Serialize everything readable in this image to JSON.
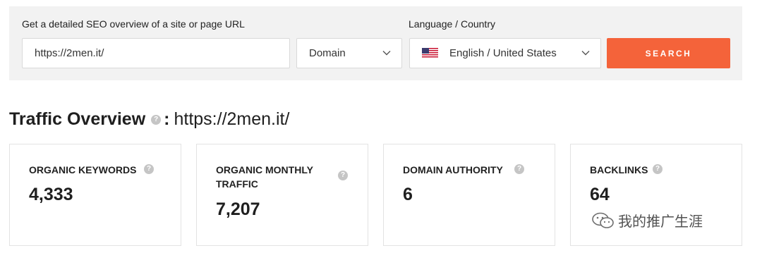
{
  "search": {
    "url_label": "Get a detailed SEO overview of a site or page URL",
    "url_value": "https://2men.it/",
    "scope_selected": "Domain",
    "language_label": "Language / Country",
    "country_selected": "English / United States",
    "search_button": "SEARCH",
    "accent_color": "#f4633a"
  },
  "overview": {
    "title": "Traffic Overview",
    "help_glyph": "?",
    "separator": ":",
    "url": "https://2men.it/"
  },
  "metrics": [
    {
      "label": "ORGANIC KEYWORDS",
      "value": "4,333",
      "help": "?"
    },
    {
      "label": "ORGANIC MONTHLY TRAFFIC",
      "value": "7,207",
      "help": "?"
    },
    {
      "label": "DOMAIN AUTHORITY",
      "value": "6",
      "help": "?"
    },
    {
      "label": "BACKLINKS",
      "value": "64",
      "help": "?"
    }
  ],
  "watermark": {
    "text": "我的推广生涯"
  }
}
